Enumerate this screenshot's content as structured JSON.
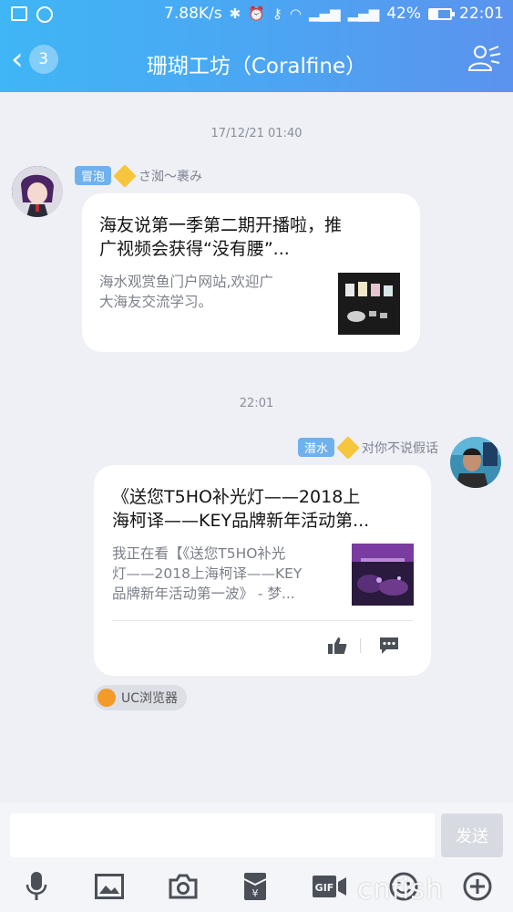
{
  "status_bar": {
    "network_speed": "7.88K/s",
    "battery": "42%",
    "battery_level": 0.42,
    "time": "22:01"
  },
  "header": {
    "back_count": "3",
    "title": "珊瑚工坊（Coralfine）"
  },
  "messages": [
    {
      "timestamp": "17/12/21 01:40",
      "tag": "冒泡",
      "sender": "さ洳～裹み",
      "card_title": "海友说第一季第二期开播啦，推广视频会获得“没有腰”...",
      "card_title_line1": "海友说第一季第二期开播啦，推",
      "card_title_line2": "广视频会获得“没有腰”...",
      "card_desc_line1": "海水观赏鱼门户网站,欢迎广",
      "card_desc_line2": "大海友交流学习。"
    },
    {
      "timestamp": "22:01",
      "tag": "潜水",
      "sender": "对你不说假话",
      "card_title_line1": "《送您T5HO补光灯——2018上",
      "card_title_line2": "海柯译——KEY品牌新年活动第...",
      "card_desc_line1": "我正在看【《送您T5HO补光",
      "card_desc_line2": "灯——2018上海柯译——KEY",
      "card_desc_line3": "品牌新年活动第一波》 - 梦...",
      "source_label": "UC浏览器"
    }
  ],
  "input": {
    "placeholder": "",
    "send_label": "发送"
  },
  "watermark": "cnfish",
  "colors": {
    "header_gradient_start": "#3fb6f5",
    "header_gradient_end": "#5b93ee",
    "tag_blue": "#6fb1ee",
    "background": "#eef0f6"
  }
}
